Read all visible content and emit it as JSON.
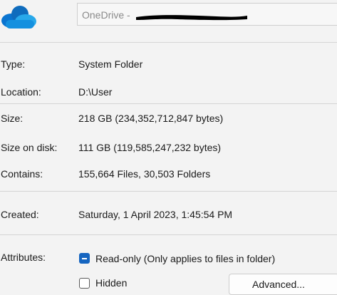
{
  "header": {
    "icon": "onedrive-cloud-icon",
    "folder_name_prefix": "OneDrive -",
    "accent_color": "#0364b8"
  },
  "properties": {
    "type": {
      "label": "Type:",
      "value": "System Folder"
    },
    "location": {
      "label": "Location:",
      "value": "D:\\User"
    },
    "size": {
      "label": "Size:",
      "value": "218 GB (234,352,712,847 bytes)"
    },
    "size_on_disk": {
      "label": "Size on disk:",
      "value": "111 GB (119,585,247,232 bytes)"
    },
    "contains": {
      "label": "Contains:",
      "value": "155,664 Files, 30,503 Folders"
    },
    "created": {
      "label": "Created:",
      "value": "Saturday, 1 April 2023, 1:45:54 PM"
    }
  },
  "attributes": {
    "label": "Attributes:",
    "read_only": {
      "label": "Read-only (Only applies to files in folder)",
      "state": "indeterminate"
    },
    "hidden": {
      "label": "Hidden",
      "state": "unchecked"
    },
    "advanced_label": "Advanced..."
  }
}
